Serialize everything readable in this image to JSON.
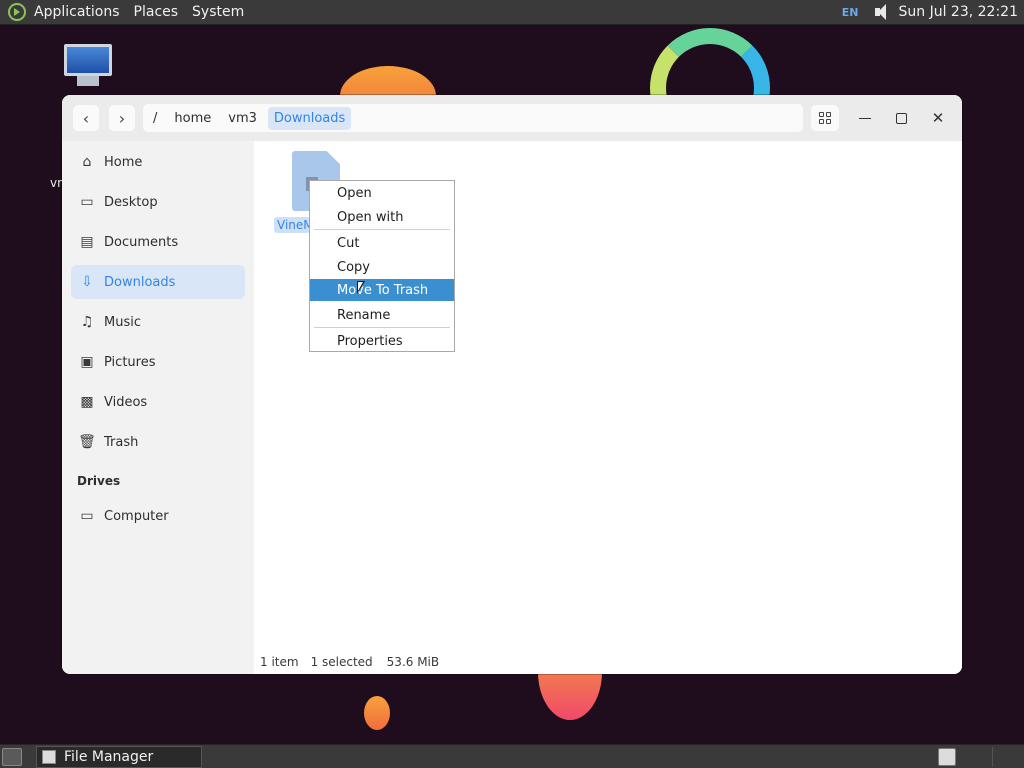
{
  "top_panel": {
    "menus": [
      "Applications",
      "Places",
      "System"
    ],
    "keyboard_layout": "EN",
    "clock": "Sun Jul 23, 22:21"
  },
  "desktop": {
    "icon_label_fragment": "vn"
  },
  "window": {
    "path": {
      "root": "/",
      "segments": [
        "home",
        "vm3",
        "Downloads"
      ]
    },
    "sidebar": {
      "places": [
        {
          "label": "Home",
          "icon": "home-icon"
        },
        {
          "label": "Desktop",
          "icon": "desktop-icon"
        },
        {
          "label": "Documents",
          "icon": "document-icon"
        },
        {
          "label": "Downloads",
          "icon": "download-icon",
          "active": true
        },
        {
          "label": "Music",
          "icon": "music-icon"
        },
        {
          "label": "Pictures",
          "icon": "picture-icon"
        },
        {
          "label": "Videos",
          "icon": "video-icon"
        },
        {
          "label": "Trash",
          "icon": "trash-icon"
        }
      ],
      "drives_heading": "Drives",
      "drives": [
        {
          "label": "Computer",
          "icon": "computer-icon"
        }
      ]
    },
    "file": {
      "label": "VineM"
    },
    "status": {
      "items": "1 item",
      "selected": "1 selected",
      "size": "53.6 MiB"
    }
  },
  "context_menu": {
    "items": [
      "Open",
      "Open with",
      "Cut",
      "Copy",
      "Move To Trash",
      "Rename",
      "Properties"
    ],
    "highlighted": "Move To Trash"
  },
  "taskbar": {
    "task_label": "File Manager"
  },
  "colors": {
    "accent": "#3584e4",
    "menu_highlight": "#3a8fd0",
    "panel": "#3a3a3a"
  }
}
